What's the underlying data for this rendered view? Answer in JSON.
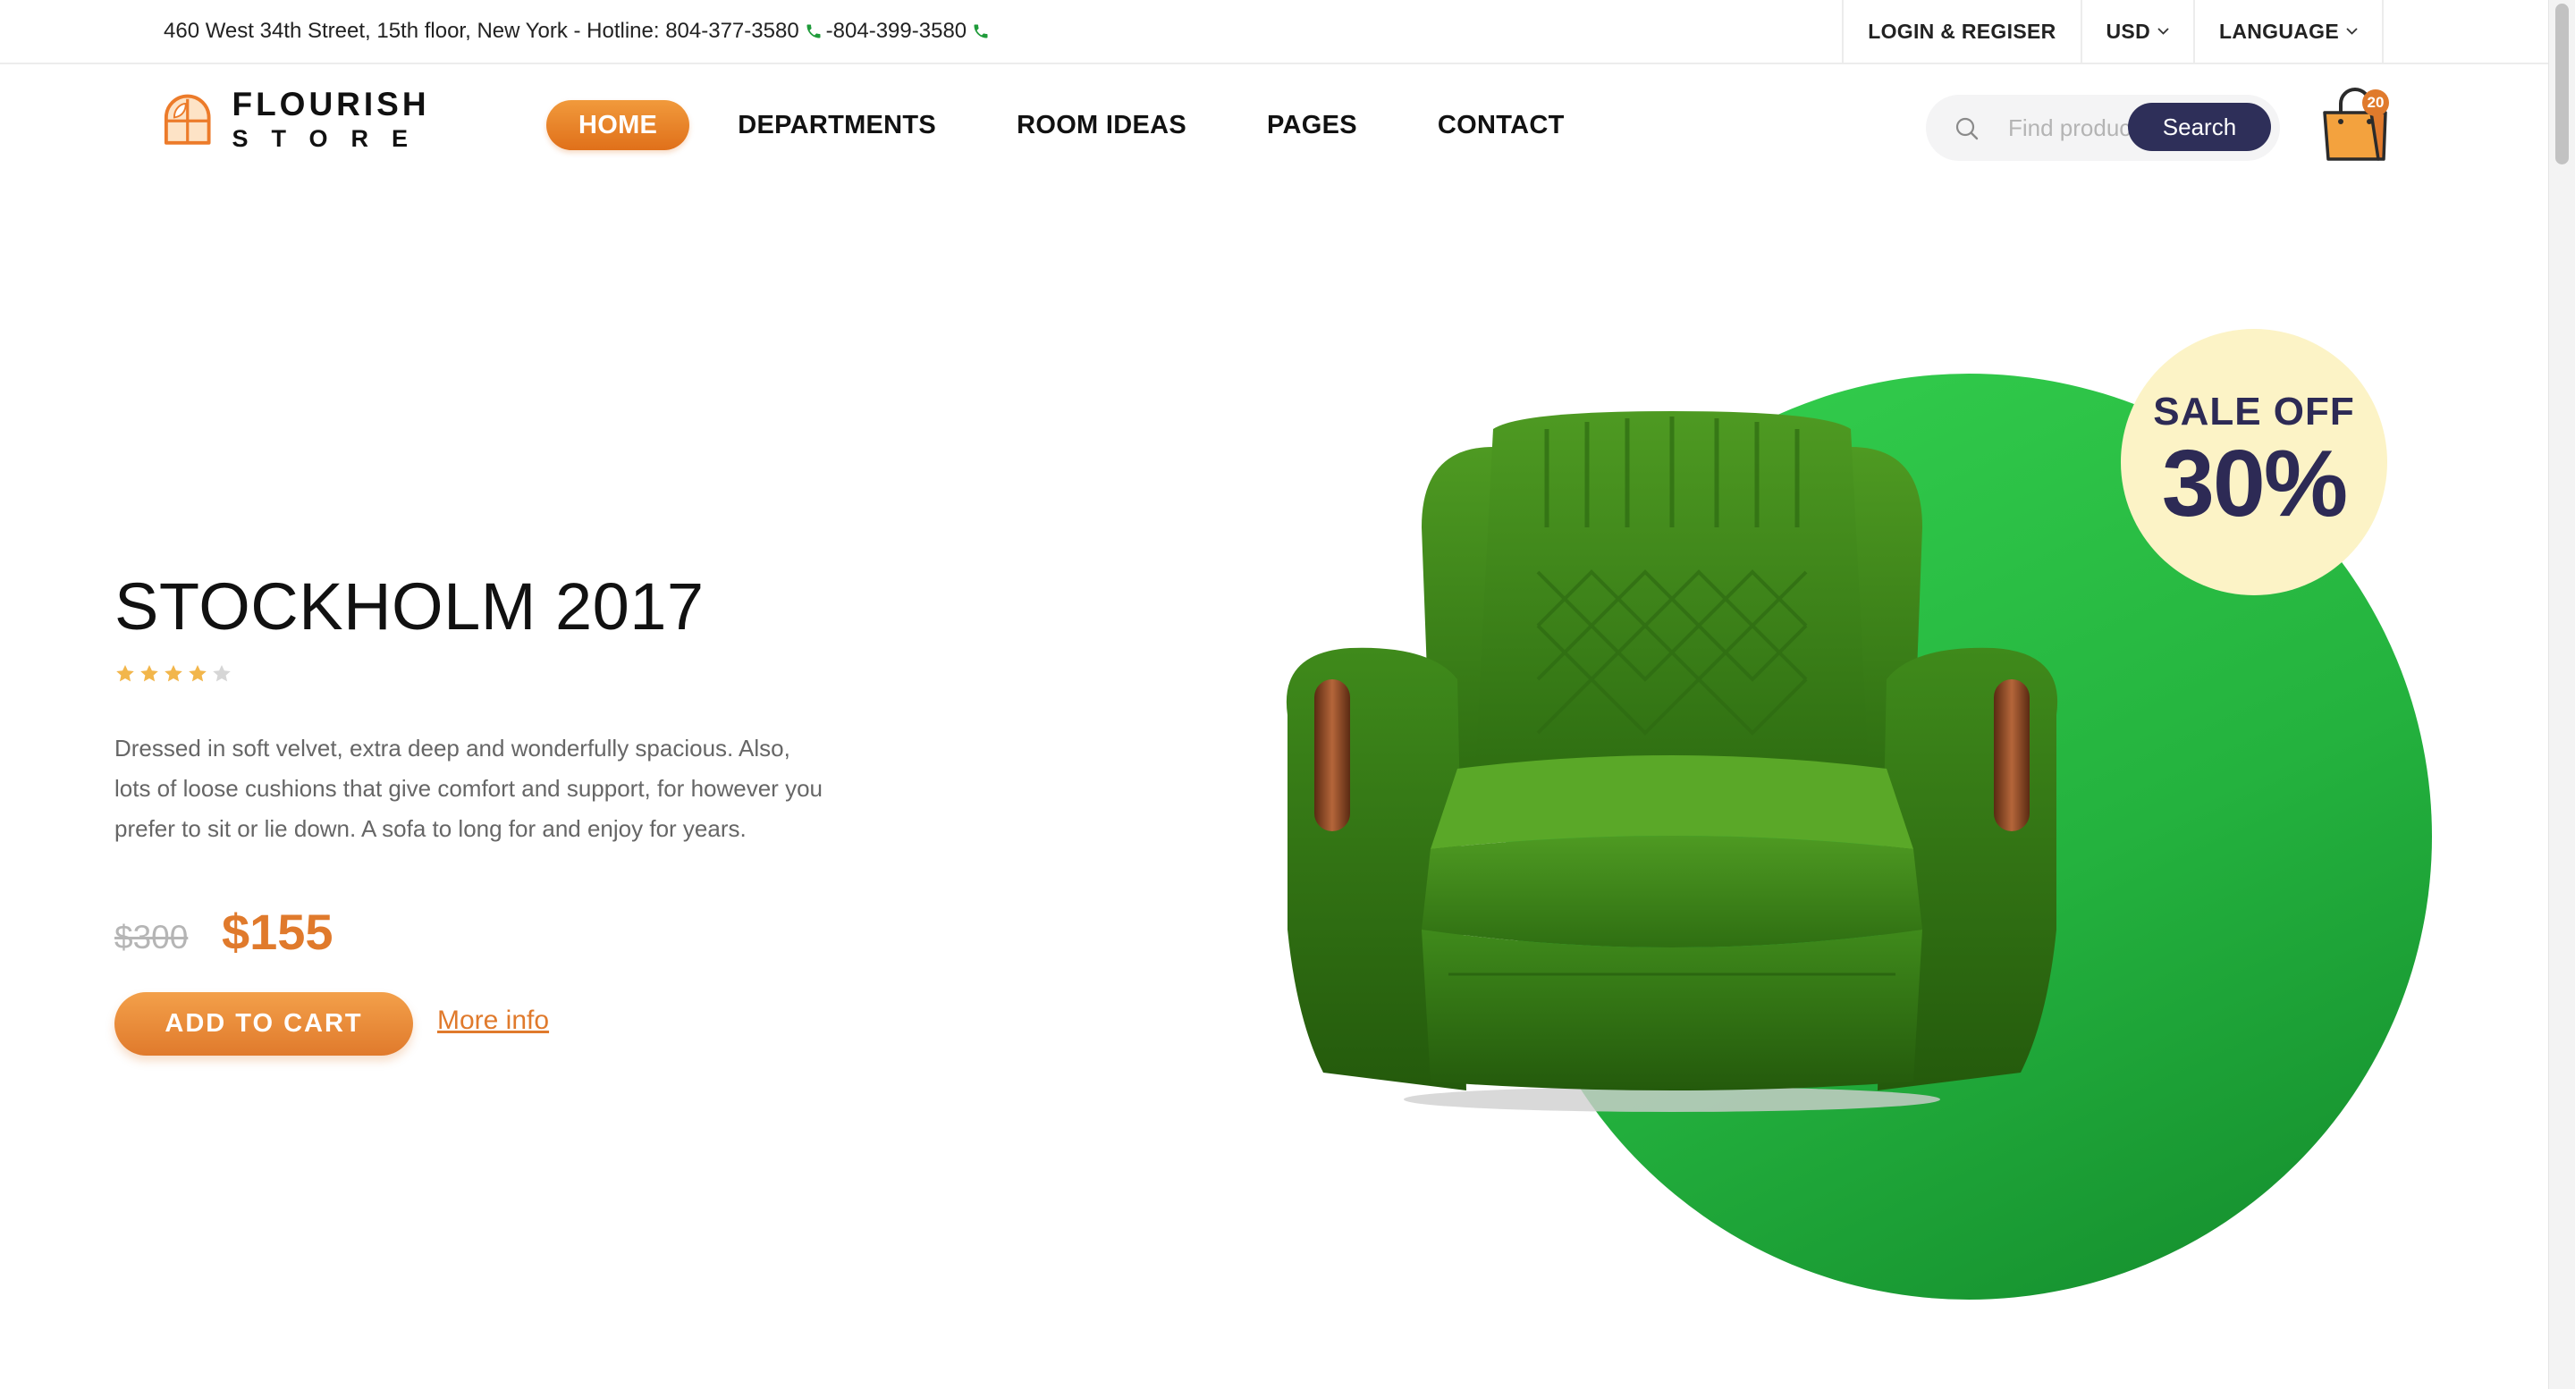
{
  "topbar": {
    "address": "460 West 34th Street, 15th floor, New York - Hotline: 804-377-3580",
    "separator": "- ",
    "phone2": "804-399-3580",
    "login_label": "LOGIN & REGISER",
    "currency": "USD",
    "language": "LANGUAGE"
  },
  "logo": {
    "name": "FLOURISH",
    "sub": "STORE"
  },
  "nav": {
    "items": [
      "HOME",
      "DEPARTMENTS",
      "ROOM IDEAS",
      "PAGES",
      "CONTACT"
    ],
    "active_index": 0
  },
  "search": {
    "placeholder": "Find product",
    "button_label": "Search"
  },
  "cart": {
    "count": "20"
  },
  "hero": {
    "title": "STOCKHOLM 2017",
    "rating": 4,
    "rating_max": 5,
    "description": "Dressed in soft velvet, extra deep and wonderfully spacious. Also, lots of loose cushions that give comfort and support, for however you prefer to sit or lie down. A sofa to long for and enjoy for years.",
    "price_old": "$300",
    "price_new": "$155",
    "add_to_cart": "ADD TO CART",
    "more_info": "More info"
  },
  "sale": {
    "label": "SALE OFF",
    "percent": "30%"
  },
  "icons": {
    "search": "search-icon",
    "cart": "shopping-bag-icon",
    "phone": "phone-icon",
    "chevron": "chevron-down-icon",
    "star": "star-icon"
  },
  "colors": {
    "accent": "#e07a2c",
    "search_button": "#2e2f59",
    "hero_circle": "#24b23e",
    "sale_badge_bg": "#fcf3c6",
    "sale_text": "#2d2a55",
    "star_filled": "#f2b64b",
    "star_empty": "#d6d6d6"
  }
}
